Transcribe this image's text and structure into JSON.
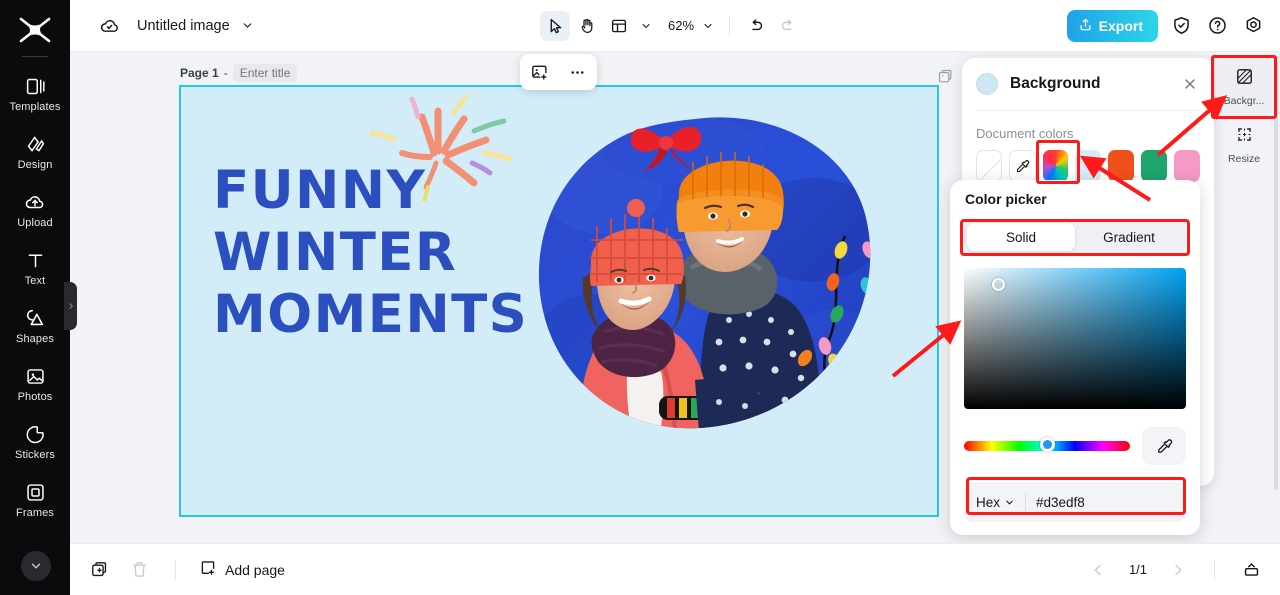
{
  "app": {
    "brand_icon": "capcut-logo-icon",
    "accent": "#22c8f0",
    "canvas_bg": "#d3edf8",
    "headline_color": "#2c4fc0",
    "highlight_color": "#ff1a1a"
  },
  "left_rail": {
    "items": [
      {
        "label": "Templates",
        "icon": "templates-icon"
      },
      {
        "label": "Design",
        "icon": "design-icon"
      },
      {
        "label": "Upload",
        "icon": "upload-cloud-icon"
      },
      {
        "label": "Text",
        "icon": "text-t-icon"
      },
      {
        "label": "Shapes",
        "icon": "shapes-icon"
      },
      {
        "label": "Photos",
        "icon": "photo-icon"
      },
      {
        "label": "Stickers",
        "icon": "sticker-icon"
      },
      {
        "label": "Frames",
        "icon": "frames-icon"
      }
    ],
    "more_icon": "chevron-down-icon",
    "collapse_icon": "chevron-right-icon"
  },
  "topbar": {
    "cloud_icon": "cloud-saved-icon",
    "doc_title": "Untitled image",
    "title_caret": "chevron-down-icon",
    "tools": [
      {
        "name": "select-tool",
        "icon": "cursor-arrow-icon",
        "active": true
      },
      {
        "name": "hand-tool",
        "icon": "hand-icon",
        "active": false
      },
      {
        "name": "layout-tool",
        "icon": "layout-grid-icon",
        "active": false
      }
    ],
    "zoom_level": "62%",
    "undo_icon": "undo-arrow-icon",
    "redo_icon": "redo-arrow-icon",
    "export_label": "Export",
    "export_icon": "export-upload-icon",
    "shield_icon": "shield-check-icon",
    "help_icon": "question-circle-icon",
    "settings_icon": "gear-icon"
  },
  "workspace": {
    "page_label": "Page 1",
    "page_dash": "-",
    "page_title_placeholder": "Enter title",
    "page_title_value": "",
    "float_tools": [
      {
        "name": "add-image-button",
        "icon": "add-image-icon"
      },
      {
        "name": "more-options-button",
        "icon": "ellipsis-icon"
      }
    ],
    "page_actions": [
      {
        "name": "duplicate-page-button",
        "icon": "duplicate-page-icon"
      },
      {
        "name": "page-more-button",
        "icon": "ellipsis-icon"
      }
    ],
    "canvas": {
      "headline_lines": [
        "FUNNY",
        "WINTER",
        "MOMENTS"
      ],
      "photo_alt": "two-children-winter-hats-photo",
      "decor": "fireworks-burst-graphic"
    }
  },
  "bottombar": {
    "duplicate_icon": "duplicate-icon",
    "delete_icon": "trash-icon",
    "add_page_label": "Add page",
    "add_page_icon": "add-page-icon",
    "prev_icon": "chevron-left-icon",
    "page_count": "1/1",
    "next_icon": "chevron-right-icon",
    "grid_view_icon": "pages-panel-icon"
  },
  "right_panel": {
    "title": "Background",
    "close_icon": "close-icon",
    "section_label": "Document colors",
    "swatches": [
      {
        "name": "no-color-swatch",
        "type": "none",
        "color": ""
      },
      {
        "name": "eyedropper-swatch",
        "type": "eyedropper",
        "color": ""
      },
      {
        "name": "color-wheel-swatch",
        "type": "wheel",
        "color": "",
        "highlighted": true
      },
      {
        "name": "light-blue-swatch",
        "type": "solid",
        "color": "#d3edf8"
      },
      {
        "name": "orange-red-swatch",
        "type": "solid",
        "color": "#f2501a"
      },
      {
        "name": "green-swatch",
        "type": "solid",
        "color": "#1fa46c"
      },
      {
        "name": "pink-swatch",
        "type": "solid",
        "color": "#f59ac4"
      }
    ]
  },
  "color_picker": {
    "title": "Color picker",
    "tabs": [
      {
        "label": "Solid",
        "active": true
      },
      {
        "label": "Gradient",
        "active": false
      }
    ],
    "sv_hue": "#00a2f3",
    "hue_position_pct": 46,
    "eyedropper_icon": "eyedropper-icon",
    "format_label": "Hex",
    "format_caret": "chevron-down-icon",
    "hex_value": "#d3edf8"
  },
  "right_rail": {
    "items": [
      {
        "label": "Backgr...",
        "icon": "background-icon",
        "active": true
      },
      {
        "label": "Resize",
        "icon": "resize-icon",
        "active": false
      }
    ]
  },
  "annotations": {
    "arrow_count": 3,
    "highlight_boxes": [
      "background-tool-button",
      "color-wheel-swatch",
      "solid-gradient-tabs",
      "hex-input-row"
    ]
  }
}
